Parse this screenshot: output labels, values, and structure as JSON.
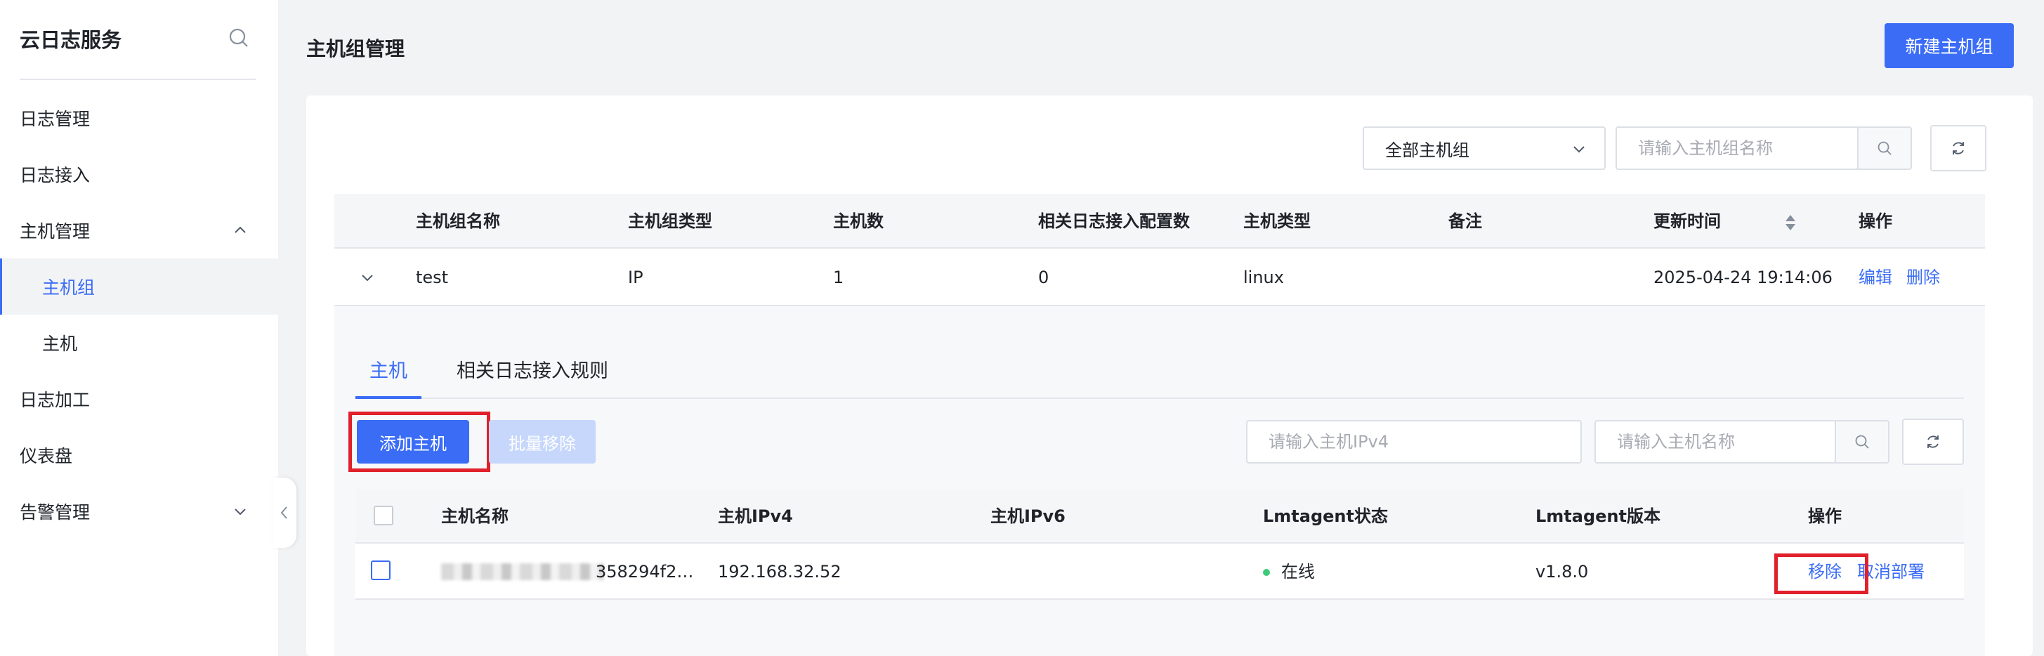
{
  "sidebar": {
    "title": "云日志服务",
    "items": [
      {
        "label": "日志管理"
      },
      {
        "label": "日志接入"
      },
      {
        "label": "主机管理"
      },
      {
        "label": "主机组"
      },
      {
        "label": "主机"
      },
      {
        "label": "日志加工"
      },
      {
        "label": "仪表盘"
      },
      {
        "label": "告警管理"
      }
    ]
  },
  "header": {
    "title": "主机组管理",
    "new_group_label": "新建主机组"
  },
  "filters": {
    "group_select": "全部主机组",
    "search_placeholder": "请输入主机组名称"
  },
  "table": {
    "columns": [
      "主机组名称",
      "主机组类型",
      "主机数",
      "相关日志接入配置数",
      "主机类型",
      "备注",
      "更新时间",
      "操作"
    ],
    "rows": [
      {
        "name": "test",
        "type": "IP",
        "host_count": "1",
        "config_count": "0",
        "host_type": "linux",
        "remark": "",
        "updated": "2025-04-24 19:14:06",
        "edit_label": "编辑",
        "delete_label": "删除"
      }
    ]
  },
  "detail": {
    "tabs": [
      "主机",
      "相关日志接入规则"
    ],
    "add_host_label": "添加主机",
    "batch_remove_label": "批量移除",
    "ipv4_placeholder": "请输入主机IPv4",
    "name_placeholder": "请输入主机名称",
    "columns": [
      "主机名称",
      "主机IPv4",
      "主机IPv6",
      "Lmtagent状态",
      "Lmtagent版本",
      "操作"
    ],
    "rows": [
      {
        "name_suffix": "358294f2…",
        "ipv4": "192.168.32.52",
        "ipv6": "",
        "status": "在线",
        "version": "v1.8.0",
        "remove_label": "移除",
        "undeploy_label": "取消部署"
      }
    ]
  },
  "colors": {
    "accent": "#3a6cf6",
    "online": "#3dc97a",
    "highlight": "#e0202b"
  }
}
